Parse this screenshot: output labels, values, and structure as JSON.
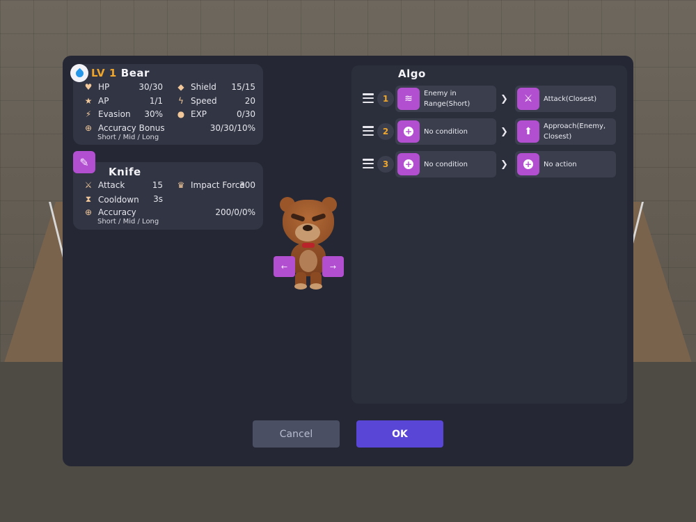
{
  "character": {
    "level_label": "LV 1",
    "name": "Bear",
    "stats": {
      "hp": {
        "label": "HP",
        "value": "30/30"
      },
      "ap": {
        "label": "AP",
        "value": "1/1"
      },
      "evasion": {
        "label": "Evasion",
        "value": "30%"
      },
      "shield": {
        "label": "Shield",
        "value": "15/15"
      },
      "speed": {
        "label": "Speed",
        "value": "20"
      },
      "exp": {
        "label": "EXP",
        "value": "0/30"
      },
      "accuracy_bonus": {
        "label": "Accuracy Bonus",
        "value": "30/30/10%",
        "sub": "Short / Mid / Long"
      }
    }
  },
  "weapon": {
    "name": "Knife",
    "attack": {
      "label": "Attack",
      "value": "15"
    },
    "cooldown": {
      "label": "Cooldown",
      "value": "3s"
    },
    "impact_force": {
      "label": "Impact Force",
      "value": "300"
    },
    "accuracy": {
      "label": "Accuracy",
      "value": "200/0/0%",
      "sub": "Short / Mid / Long"
    }
  },
  "nav": {
    "prev": "←",
    "next": "→"
  },
  "algo": {
    "title": "Algo",
    "rows": [
      {
        "num": "1",
        "condition": "Enemy in Range(Short)",
        "action": "Attack(Closest)"
      },
      {
        "num": "2",
        "condition": "No condition",
        "action": "Approach(Enemy, Closest)"
      },
      {
        "num": "3",
        "condition": "No condition",
        "action": "No action"
      }
    ]
  },
  "buttons": {
    "cancel": "Cancel",
    "ok": "OK"
  },
  "colors": {
    "accent_purple": "#b24fd0",
    "level_orange": "#f0a62a",
    "ok_button": "#5a46d6",
    "panel": "#252834"
  },
  "icons": {
    "hp": "heart-icon",
    "ap": "star-icon",
    "evasion": "running-icon",
    "shield": "shield-icon",
    "speed": "lightning-icon",
    "exp": "medal-icon",
    "accuracy": "crosshair-icon",
    "element": "water-drop-icon",
    "weapon": "feather-knife-icon",
    "attack": "sword-icon",
    "cooldown": "hourglass-icon",
    "impact": "crown-burst-icon",
    "range": "wifi-signal-icon",
    "attack_action": "crossed-swords-icon",
    "approach": "arrow-up-icon",
    "add": "plus-circle-icon",
    "drag": "drag-handle-icon",
    "next_step": "chevron-right-icon"
  }
}
